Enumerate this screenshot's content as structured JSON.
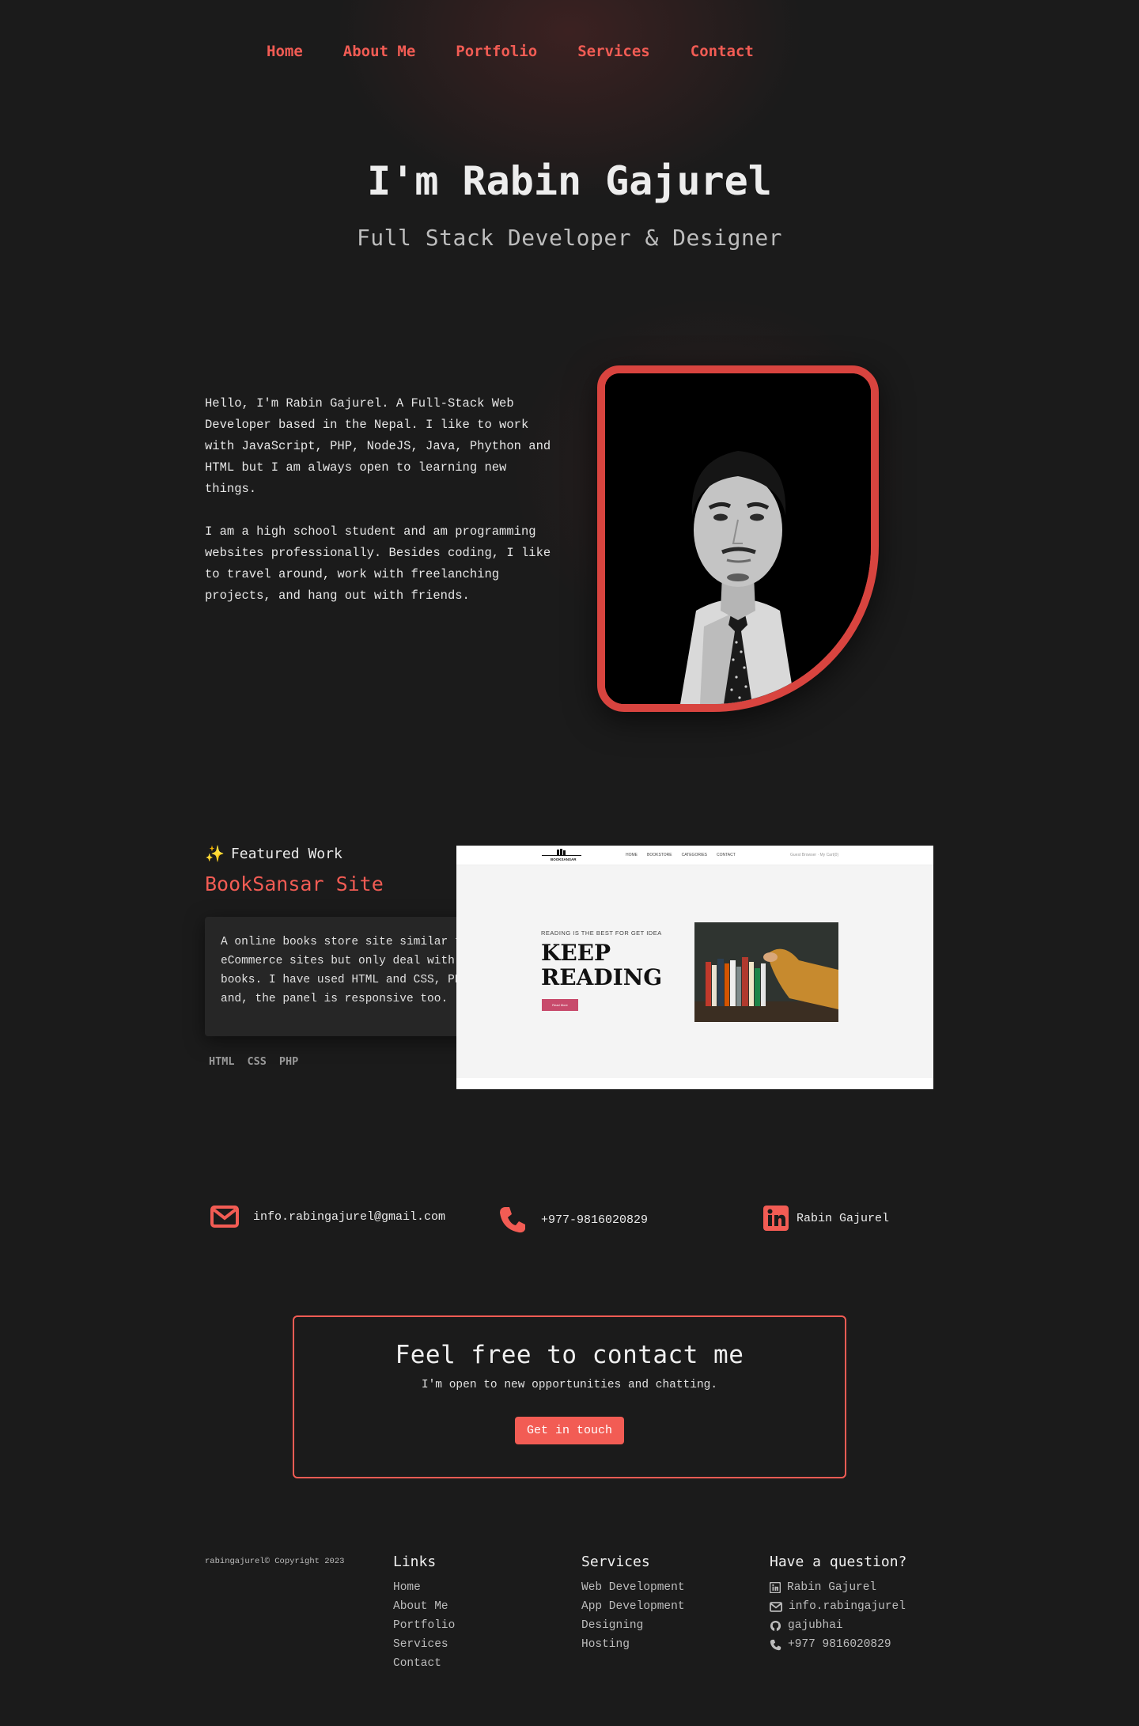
{
  "nav": {
    "items": [
      "Home",
      "About Me",
      "Portfolio",
      "Services",
      "Contact"
    ]
  },
  "hero": {
    "title": "I'm Rabin Gajurel",
    "subtitle": "Full Stack Developer & Designer"
  },
  "about": {
    "p1": "Hello, I'm Rabin Gajurel. A Full-Stack Web Developer based in the Nepal. I like to work with JavaScript, PHP, NodeJS, Java, Phython and HTML but I am always open to learning new things.",
    "p2": "I am a high school student and am programming websites professionally. Besides coding, I like to travel around, work with freelanching projects, and hang out with friends."
  },
  "featured": {
    "label": "Featured Work",
    "label_icon": "sparkles-icon",
    "title": "BookSansar Site",
    "description": "A online books store site similar to eCommerce sites but only deal with books. I have used HTML and CSS, PHP, and, the panel is responsive too.",
    "tags": [
      "HTML",
      "CSS",
      "PHP"
    ],
    "screenshot": {
      "logo": "BOOKSANSAR",
      "nav": [
        "HOME",
        "BOOKSTORE",
        "CATEGORIES",
        "CONTACT"
      ],
      "nav_right": "Guest Browser · My Cart(0)",
      "kicker": "READING IS THE BEST FOR GET IDEA",
      "headline_1": "KEEP",
      "headline_2": "READING",
      "button": "Read More"
    }
  },
  "contacts": {
    "email": "info.rabingajurel@gmail.com",
    "phone": "+977-9816020829",
    "linkedin": "Rabin Gajurel"
  },
  "cta": {
    "title": "Feel free to contact me",
    "text": "I'm open to new opportunities and chatting.",
    "button": "Get in touch"
  },
  "footer": {
    "copyright": "rabingajurel© Copyright 2023",
    "links_title": "Links",
    "links": [
      "Home",
      "About Me",
      "Portfolio",
      "Services",
      "Contact"
    ],
    "services_title": "Services",
    "services": [
      "Web Development",
      "App Development",
      "Designing",
      "Hosting"
    ],
    "question_title": "Have a question?",
    "question": [
      {
        "icon": "linkedin-icon",
        "text": "Rabin Gajurel"
      },
      {
        "icon": "envelope-icon",
        "text": "info.rabingajurel"
      },
      {
        "icon": "github-icon",
        "text": "gajubhai"
      },
      {
        "icon": "phone-icon",
        "text": "+977 9816020829"
      }
    ]
  },
  "colors": {
    "accent": "#f25c54",
    "background": "#1b1b1b",
    "card": "#262626"
  }
}
